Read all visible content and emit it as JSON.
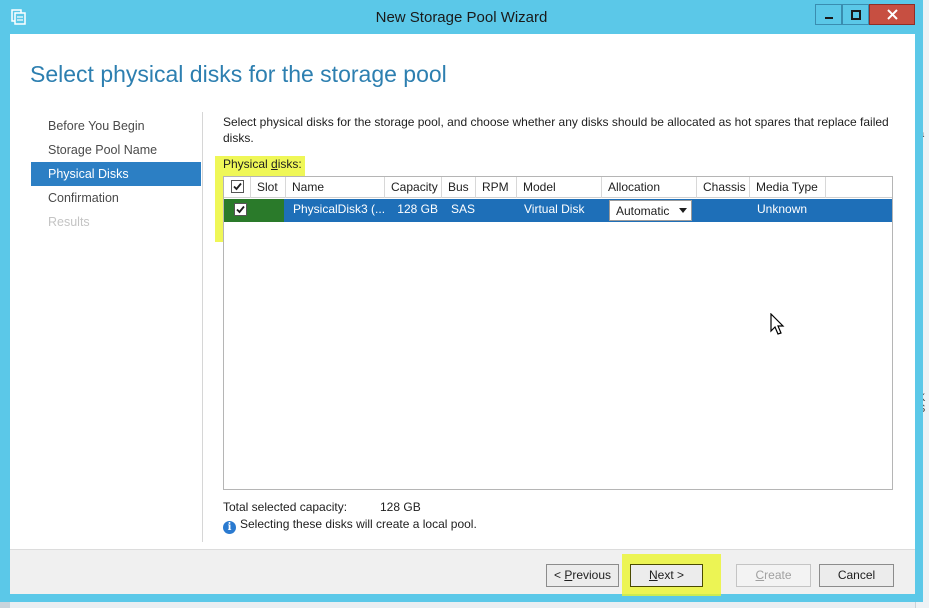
{
  "window": {
    "title": "New Storage Pool Wizard",
    "heading": "Select physical disks for the storage pool"
  },
  "nav": {
    "items": [
      {
        "label": "Before You Begin",
        "state": "normal"
      },
      {
        "label": "Storage Pool Name",
        "state": "normal"
      },
      {
        "label": "Physical Disks",
        "state": "active"
      },
      {
        "label": "Confirmation",
        "state": "normal"
      },
      {
        "label": "Results",
        "state": "disabled"
      }
    ]
  },
  "content": {
    "description": "Select physical disks for the storage pool, and choose whether any disks should be allocated as hot spares that replace failed disks.",
    "physical_disks_label_pre": "Physical ",
    "physical_disks_label_underlined": "d",
    "physical_disks_label_post": "isks:"
  },
  "grid": {
    "columns": [
      "Slot",
      "Name",
      "Capacity",
      "Bus",
      "RPM",
      "Model",
      "Allocation",
      "Chassis",
      "Media Type"
    ],
    "header_checked": true,
    "rows": [
      {
        "checked": true,
        "slot": "",
        "name": "PhysicalDisk3 (...",
        "capacity": "128 GB",
        "bus": "SAS",
        "rpm": "",
        "model": "Virtual Disk",
        "allocation": "Automatic",
        "chassis": "",
        "media_type": "Unknown"
      }
    ]
  },
  "summary": {
    "total_label": "Total selected capacity:",
    "total_value": "128 GB",
    "info_text": "Selecting these disks will create a local pool."
  },
  "footer": {
    "previous_pre": "< ",
    "previous_ul": "P",
    "previous_post": "revious",
    "next_ul": "N",
    "next_post": "ext >",
    "create_ul": "C",
    "create_post": "reate",
    "cancel_label": "Cancel"
  },
  "colors": {
    "title_bar": "#5bc8e8",
    "heading": "#2d7fb0",
    "selection": "#1e6fb8",
    "highlight": "#ebf528",
    "close_button": "#c74f41"
  },
  "background_fragments": [
    "a",
    "K",
    "S"
  ]
}
